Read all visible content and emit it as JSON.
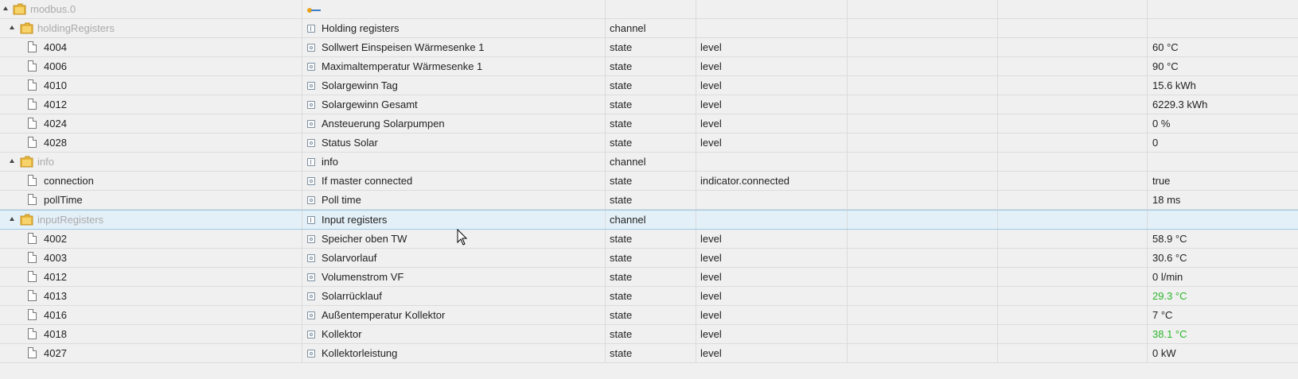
{
  "root": {
    "name": "modbus.0"
  },
  "groups": [
    {
      "id": "holdingRegisters",
      "name": "holdingRegisters",
      "title": "Holding registers",
      "type": "channel",
      "rows": [
        {
          "name": "4004",
          "title": "Sollwert Einspeisen Wärmesenke 1",
          "type": "state",
          "role": "level",
          "value": "60 °C"
        },
        {
          "name": "4006",
          "title": "Maximaltemperatur Wärmesenke 1",
          "type": "state",
          "role": "level",
          "value": "90 °C"
        },
        {
          "name": "4010",
          "title": "Solargewinn Tag",
          "type": "state",
          "role": "level",
          "value": "15.6 kWh"
        },
        {
          "name": "4012",
          "title": "Solargewinn Gesamt",
          "type": "state",
          "role": "level",
          "value": "6229.3 kWh"
        },
        {
          "name": "4024",
          "title": "Ansteuerung Solarpumpen",
          "type": "state",
          "role": "level",
          "value": "0 %"
        },
        {
          "name": "4028",
          "title": "Status Solar",
          "type": "state",
          "role": "level",
          "value": "0"
        }
      ]
    },
    {
      "id": "info",
      "name": "info",
      "title": "info",
      "type": "channel",
      "rows": [
        {
          "name": "connection",
          "title": "If master connected",
          "type": "state",
          "role": "indicator.connected",
          "value": "true"
        },
        {
          "name": "pollTime",
          "title": "Poll time",
          "type": "state",
          "role": "",
          "value": "18 ms"
        }
      ]
    },
    {
      "id": "inputRegisters",
      "name": "inputRegisters",
      "title": "Input registers",
      "type": "channel",
      "selected": true,
      "rows": [
        {
          "name": "4002",
          "title": "Speicher oben TW",
          "type": "state",
          "role": "level",
          "value": "58.9 °C"
        },
        {
          "name": "4003",
          "title": "Solarvorlauf",
          "type": "state",
          "role": "level",
          "value": "30.6 °C"
        },
        {
          "name": "4012",
          "title": "Volumenstrom VF",
          "type": "state",
          "role": "level",
          "value": "0 l/min"
        },
        {
          "name": "4013",
          "title": "Solarrücklauf",
          "type": "state",
          "role": "level",
          "value": "29.3 °C",
          "highlight": true
        },
        {
          "name": "4016",
          "title": "Außentemperatur Kollektor",
          "type": "state",
          "role": "level",
          "value": "7 °C"
        },
        {
          "name": "4018",
          "title": "Kollektor",
          "type": "state",
          "role": "level",
          "value": "38.1 °C",
          "highlight": true
        },
        {
          "name": "4027",
          "title": "Kollektorleistung",
          "type": "state",
          "role": "level",
          "value": "0 kW"
        }
      ]
    }
  ],
  "colors": {
    "highlight_value": "#2cb52c",
    "selection": "#e4f0f8"
  },
  "icons": {
    "folder": "folder-icon",
    "file": "file-icon",
    "channel": "channel-icon",
    "state": "state-icon",
    "adapter": "modbus-adapter-icon"
  }
}
